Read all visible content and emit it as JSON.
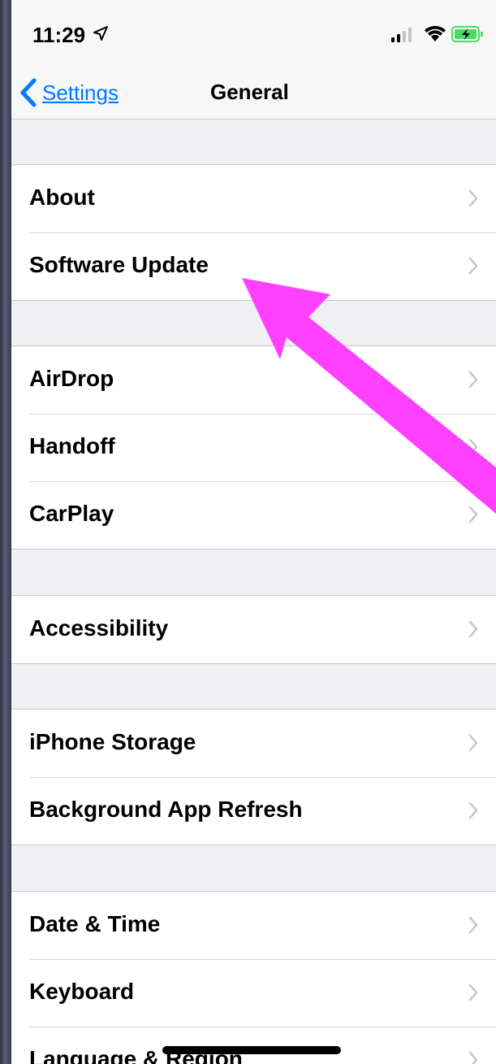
{
  "status_bar": {
    "time": "11:29",
    "icons": [
      "location-arrow-icon",
      "cellular-signal-icon",
      "wifi-icon",
      "battery-charging-icon"
    ],
    "battery_color": "#4cd964"
  },
  "nav": {
    "back_label": "Settings",
    "title": "General",
    "accent_color": "#007aff"
  },
  "groups": [
    {
      "rows": [
        {
          "label": "About"
        },
        {
          "label": "Software Update"
        }
      ]
    },
    {
      "rows": [
        {
          "label": "AirDrop"
        },
        {
          "label": "Handoff"
        },
        {
          "label": "CarPlay"
        }
      ]
    },
    {
      "rows": [
        {
          "label": "Accessibility"
        }
      ]
    },
    {
      "rows": [
        {
          "label": "iPhone Storage"
        },
        {
          "label": "Background App Refresh"
        }
      ]
    },
    {
      "rows": [
        {
          "label": "Date & Time"
        },
        {
          "label": "Keyboard"
        },
        {
          "label": "Language & Region"
        }
      ]
    }
  ],
  "annotation": {
    "arrow_color": "#ff40ff",
    "points_to": "Software Update"
  }
}
